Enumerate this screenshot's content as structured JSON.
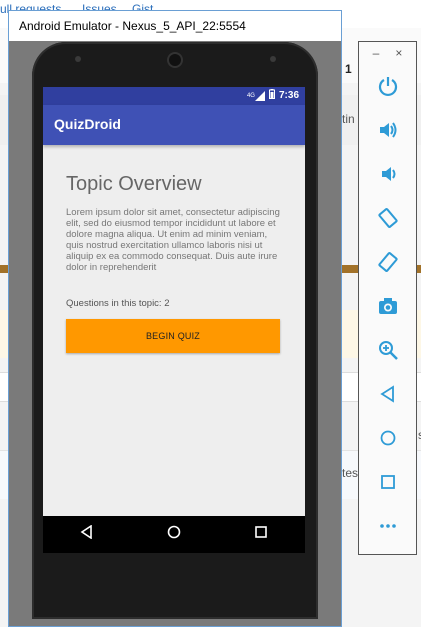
{
  "background": {
    "links": [
      "ull requests",
      "Issues",
      "Gist"
    ],
    "right_texts": [
      "1",
      "tin",
      "s",
      "tes"
    ]
  },
  "emulator": {
    "window_title": "Android Emulator - Nexus_5_API_22:5554"
  },
  "status_bar": {
    "signal": "4G",
    "time": "7:36"
  },
  "app": {
    "title": "QuizDroid",
    "topic_title": "Topic Overview",
    "topic_description": "Lorem ipsum dolor sit amet, consectetur adipiscing elit, sed do eiusmod tempor incididunt ut labore et dolore magna aliqua. Ut enim ad minim veniam, quis nostrud exercitation ullamco laboris nisi ut aliquip ex ea commodo consequat. Duis aute irure dolor in reprehenderit",
    "question_count": "Questions in this topic: 2",
    "begin_button": "BEGIN QUIZ"
  },
  "side_panel": {
    "minimize": "–",
    "close": "×",
    "buttons": [
      "power-icon",
      "volume-up-icon",
      "volume-down-icon",
      "rotate-left-icon",
      "rotate-right-icon",
      "camera-icon",
      "zoom-icon",
      "back-icon",
      "home-icon",
      "overview-icon",
      "more-icon"
    ]
  },
  "colors": {
    "primary": "#3f51b5",
    "primary_dark": "#303f9f",
    "accent": "#ff9800",
    "side_icon": "#2e9bd6"
  }
}
